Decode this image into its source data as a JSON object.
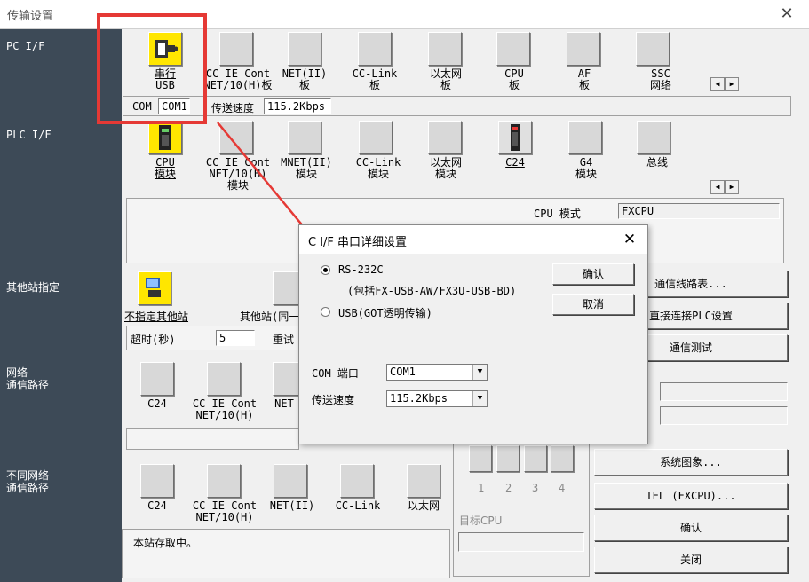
{
  "window": {
    "title": "传输设置"
  },
  "sections": {
    "pc_if": "PC I/F",
    "plc_if": "PLC I/F",
    "other_station": "其他站指定",
    "network_route": "网络\n通信路径",
    "diff_network_route": "不同网络\n通信路径"
  },
  "pc_if_items": [
    "串行\nUSB",
    "CC IE Cont\nNET/10(H)板",
    "NET(II)\n板",
    "CC-Link\n板",
    "以太网\n板",
    "CPU\n板",
    "AF\n板",
    "SSC\n网络"
  ],
  "pc_if_com": {
    "label": "COM",
    "value": "COM1",
    "speed_label": "传送速度",
    "speed_value": "115.2Kbps"
  },
  "plc_if_items": [
    "CPU\n模块",
    "CC IE Cont\nNET/10(H)\n模块",
    "MNET(II)\n模块",
    "CC-Link\n模块",
    "以太网\n模块",
    "C24",
    "G4\n模块",
    "总线"
  ],
  "plc_detail": {
    "cpu_mode_label": "CPU 模式",
    "cpu_mode_value": "FXCPU"
  },
  "other_station": {
    "no_specify": "不指定其他站",
    "same_loop": "其他站(同一",
    "timeout_label": "超时(秒)",
    "timeout_value": "5",
    "retry_label": "重试"
  },
  "network_items": [
    "C24",
    "CC IE Cont\nNET/10(H)",
    "NET"
  ],
  "diff_network_items": [
    "C24",
    "CC IE Cont\nNET/10(H)",
    "NET(II)",
    "CC-Link",
    "以太网"
  ],
  "status_text": "本站存取中。",
  "multi_cpu": {
    "nums": [
      "1",
      "2",
      "3",
      "4"
    ],
    "target_label": "目标CPU"
  },
  "right_buttons": [
    "通信线路表...",
    "直接连接PLC设置",
    "通信测试",
    "系统图象...",
    "TEL (FXCPU)...",
    "确认",
    "关闭"
  ],
  "dialog": {
    "title": "C I/F 串口详细设置",
    "radio_rs232": "RS-232C",
    "radio_rs232_note": "(包括FX-USB-AW/FX3U-USB-BD)",
    "radio_usb": "USB(GOT透明传输)",
    "ok": "确认",
    "cancel": "取消",
    "com_label": "COM 端口",
    "com_value": "COM1",
    "speed_label": "传送速度",
    "speed_value": "115.2Kbps"
  },
  "colors": {
    "left_panel": "#3d4a57",
    "highlight": "#e53935",
    "icon_selected": "#ffe600"
  }
}
